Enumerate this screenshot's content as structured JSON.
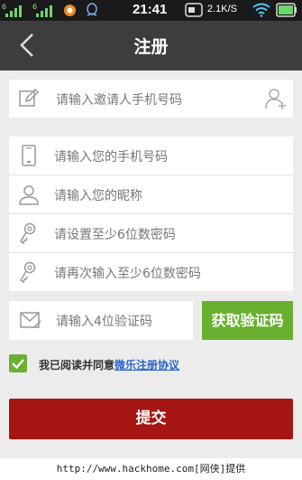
{
  "status_bar": {
    "signal_1": "6",
    "signal_2": "6",
    "time": "21:41",
    "network_speed": "2.1K/S"
  },
  "nav": {
    "title": "注册"
  },
  "invite": {
    "placeholder": "请输入邀请人手机号码"
  },
  "form": {
    "phone_placeholder": "请输入您的手机号码",
    "nickname_placeholder": "请输入您的昵称",
    "password_placeholder": "请设置至少6位数密码",
    "confirm_placeholder": "请再次输入至少6位数密码"
  },
  "verify": {
    "placeholder": "请输入4位验证码",
    "button_label": "获取验证码"
  },
  "agreement": {
    "text": "我已阅读并同意",
    "link_text": "微乐注册协议",
    "checked": true
  },
  "submit_label": "提交",
  "watermark": "http://www.hackhome.com[网侠]提供",
  "colors": {
    "accent_green": "#69b030",
    "submit_red": "#a51613",
    "link_blue": "#2a62c8",
    "nav_bg": "#3d3d3d"
  }
}
